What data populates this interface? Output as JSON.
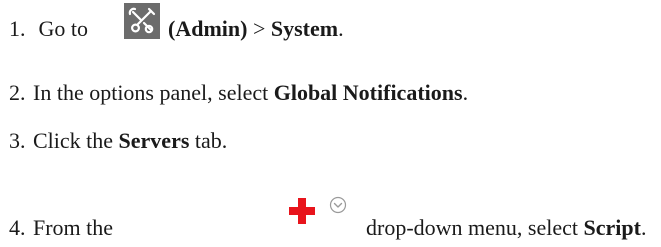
{
  "steps": [
    {
      "number": "1.",
      "prefix": "Go to ",
      "icon": "admin-tools-icon",
      "bold_a": "(Admin)",
      "middle": " > ",
      "bold_b": "System",
      "suffix": "."
    },
    {
      "number": "2.",
      "prefix": "In the options panel, select ",
      "bold": "Global Notifications",
      "suffix": "."
    },
    {
      "number": "3.",
      "prefix": "Click the ",
      "bold": "Servers",
      "suffix": " tab."
    },
    {
      "number": "4.",
      "prefix": "From the",
      "icon_add": "red-plus-icon",
      "icon_dropdown": "chevron-down-circle-icon",
      "middle": "drop-down menu, select ",
      "bold": "Script",
      "suffix": "."
    }
  ],
  "colors": {
    "text": "#1a1a1a",
    "admin_icon_bg": "#6c6c6c",
    "add_icon": "#e8141c",
    "chevron": "#9a9a9a"
  }
}
